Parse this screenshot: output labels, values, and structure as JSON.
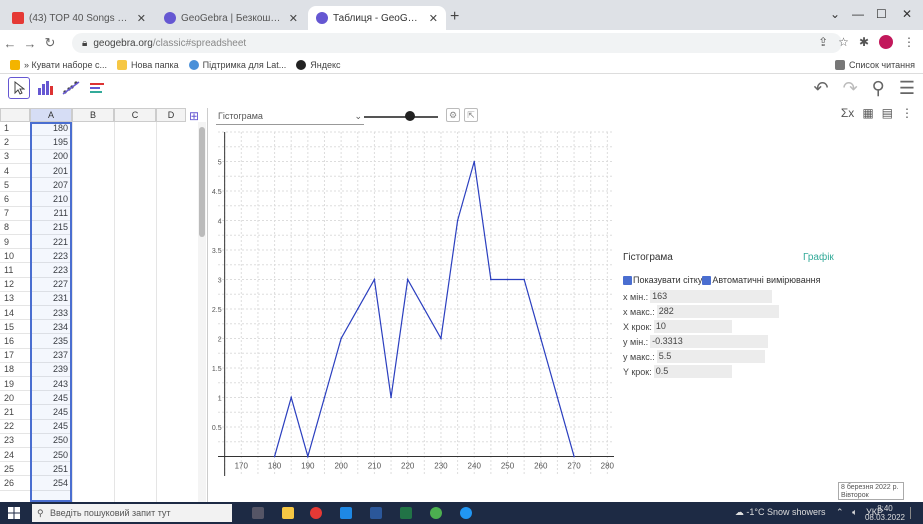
{
  "browser": {
    "tabs": [
      {
        "label": "(43) TOP 40 Songs of 2021 2022",
        "icon_color": "#e53935"
      },
      {
        "label": "GeoGebra | Безкоштовні Матем",
        "icon_color": "#6557d2"
      },
      {
        "label": "Таблиця - GeoGebra",
        "icon_color": "#6557d2"
      }
    ],
    "url_host": "geogebra.org",
    "url_path": "/classic#spreadsheet",
    "bookmarks": [
      "» Кувати наборе с...",
      "Нова папка",
      "Підтримка для Lat...",
      "Яндекс"
    ],
    "reading_list": "Список читання"
  },
  "ggb": {
    "graph_type": "Гістограма",
    "slider_value": 0.62
  },
  "spreadsheet": {
    "columns": [
      "A",
      "B",
      "C",
      "D"
    ],
    "rows": [
      {
        "n": "1",
        "a": "180"
      },
      {
        "n": "2",
        "a": "195"
      },
      {
        "n": "3",
        "a": "200"
      },
      {
        "n": "4",
        "a": "201"
      },
      {
        "n": "5",
        "a": "207"
      },
      {
        "n": "6",
        "a": "210"
      },
      {
        "n": "7",
        "a": "211"
      },
      {
        "n": "8",
        "a": "215"
      },
      {
        "n": "9",
        "a": "221"
      },
      {
        "n": "10",
        "a": "223"
      },
      {
        "n": "11",
        "a": "223"
      },
      {
        "n": "12",
        "a": "227"
      },
      {
        "n": "13",
        "a": "231"
      },
      {
        "n": "14",
        "a": "233"
      },
      {
        "n": "15",
        "a": "234"
      },
      {
        "n": "16",
        "a": "235"
      },
      {
        "n": "17",
        "a": "237"
      },
      {
        "n": "18",
        "a": "239"
      },
      {
        "n": "19",
        "a": "243"
      },
      {
        "n": "20",
        "a": "245"
      },
      {
        "n": "21",
        "a": "245"
      },
      {
        "n": "22",
        "a": "245"
      },
      {
        "n": "23",
        "a": "250"
      },
      {
        "n": "24",
        "a": "250"
      },
      {
        "n": "25",
        "a": "251"
      },
      {
        "n": "26",
        "a": "254"
      }
    ]
  },
  "chart_data": {
    "type": "line",
    "x": [
      180,
      185,
      190,
      195,
      200,
      205,
      210,
      215,
      220,
      225,
      230,
      235,
      240,
      245,
      250,
      255,
      260,
      265,
      270
    ],
    "y": [
      0,
      1,
      0,
      1,
      2,
      2.5,
      3,
      1,
      3,
      2.5,
      2,
      4,
      5,
      3,
      3,
      3,
      2,
      1,
      0
    ],
    "xlim": [
      163,
      282
    ],
    "ylim": [
      -0.3313,
      5.5
    ],
    "x_ticks": [
      "170",
      "180",
      "190",
      "200",
      "210",
      "220",
      "230",
      "240",
      "250",
      "260",
      "270",
      "280"
    ],
    "y_ticks": [
      "0.5",
      "1",
      "1.5",
      "2",
      "2.5",
      "3",
      "3.5",
      "4",
      "4.5",
      "5"
    ],
    "line_color": "#2b3fbf",
    "grid": true
  },
  "settings": {
    "tab_histogram": "Гістограма",
    "tab_graph": "Графік",
    "show_grid_label": "Показувати сітку",
    "auto_label": "Автоматичні вимірювання",
    "fields": [
      {
        "label": "x мін.:",
        "value": "163"
      },
      {
        "label": "x макс.:",
        "value": "282"
      },
      {
        "label": "X крок:",
        "value": "10"
      },
      {
        "label": "y мін.:",
        "value": "-0.3313"
      },
      {
        "label": "y макс.:",
        "value": "5.5"
      },
      {
        "label": "Y крок:",
        "value": "0.5"
      }
    ]
  },
  "taskbar": {
    "search_placeholder": "Введіть пошуковий запит тут",
    "weather": "-1°C Snow showers",
    "lang": "УКР",
    "time": "8:40",
    "date": "08.03.2022",
    "toast": "8 березня 2022 р. Вівторок"
  }
}
